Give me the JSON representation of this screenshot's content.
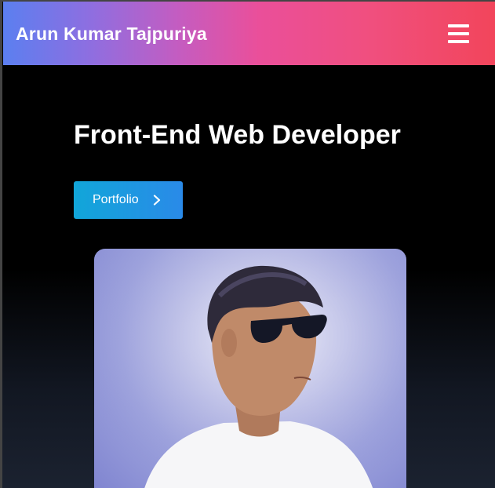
{
  "header": {
    "brand": "Arun Kumar Tajpuriya",
    "menu_icon": "hamburger-menu-icon"
  },
  "hero": {
    "title": "Front-End Web Developer",
    "button_label": "Portfolio",
    "button_icon": "chevron-right-icon"
  },
  "profile_photo": {
    "description_icon": "profile-photo"
  },
  "colors": {
    "header_gradient_start": "#5b7ff0",
    "header_gradient_mid": "#ea4f9a",
    "header_gradient_end": "#f2455b",
    "button_gradient_start": "#11a6d9",
    "button_gradient_end": "#2a8ae8",
    "page_background": "#000000"
  }
}
